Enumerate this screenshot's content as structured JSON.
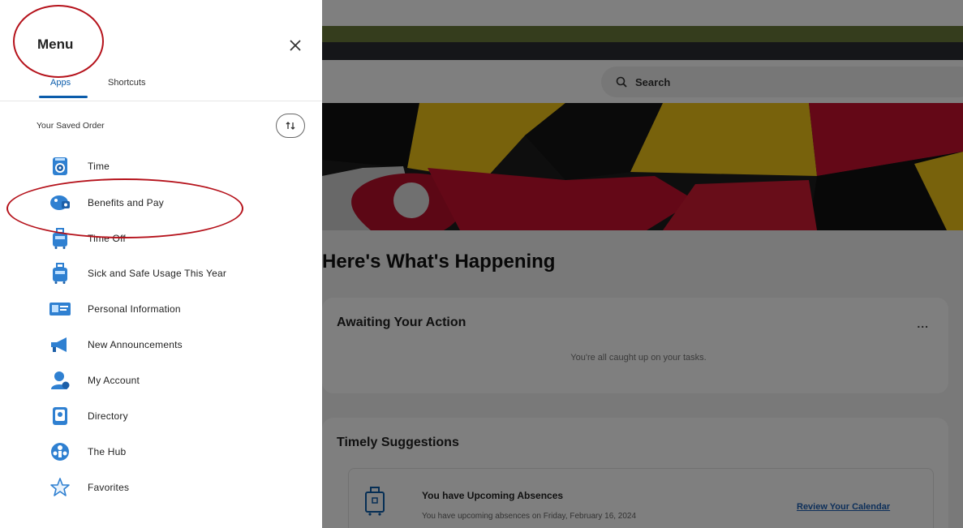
{
  "menu": {
    "title": "Menu",
    "tabs": [
      {
        "label": "Apps",
        "active": true
      },
      {
        "label": "Shortcuts",
        "active": false
      }
    ],
    "saved_order_label": "Your Saved Order",
    "items": [
      {
        "label": "Time",
        "icon": "clock-icon"
      },
      {
        "label": "Benefits and Pay",
        "icon": "piggy-bank-icon"
      },
      {
        "label": "Time Off",
        "icon": "suitcase-icon"
      },
      {
        "label": "Sick and Safe Usage This Year",
        "icon": "suitcase-icon"
      },
      {
        "label": "Personal Information",
        "icon": "id-card-icon"
      },
      {
        "label": "New Announcements",
        "icon": "megaphone-icon"
      },
      {
        "label": "My Account",
        "icon": "user-account-icon"
      },
      {
        "label": "Directory",
        "icon": "directory-book-icon"
      },
      {
        "label": "The Hub",
        "icon": "hub-people-icon"
      },
      {
        "label": "Favorites",
        "icon": "star-icon"
      }
    ]
  },
  "header": {
    "search_placeholder": "Search"
  },
  "main": {
    "greeting": "Here's What's Happening",
    "awaiting": {
      "title": "Awaiting Your Action",
      "more_label": "...",
      "empty_message": "You're all caught up on your tasks."
    },
    "suggestions": {
      "title": "Timely Suggestions",
      "item_title": "You have Upcoming Absences",
      "item_subtitle": "You have upcoming absences on Friday, February 16, 2024",
      "item_link": "Review Your Calendar"
    }
  },
  "colors": {
    "accent": "#0b5cab",
    "annotation_red": "#b5121b",
    "header_green": "#6a7a3a",
    "header_dark": "#2a2d33"
  }
}
